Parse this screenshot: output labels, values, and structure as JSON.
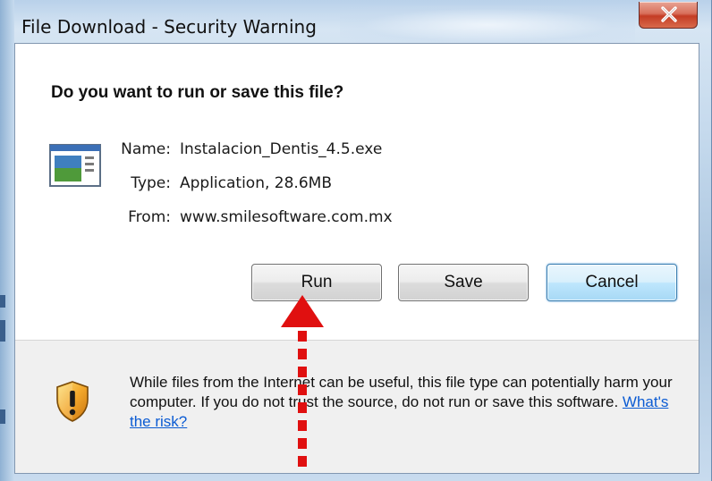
{
  "window": {
    "title": "File Download - Security Warning",
    "close_icon": "close-icon"
  },
  "dialog": {
    "question": "Do you want to run or save this file?",
    "file_icon": "application-window-icon",
    "fields": [
      {
        "label": "Name:",
        "value": "Instalacion_Dentis_4.5.exe"
      },
      {
        "label": "Type:",
        "value": "Application, 28.6MB"
      },
      {
        "label": "From:",
        "value": "www.smilesoftware.com.mx"
      }
    ],
    "buttons": {
      "run": "Run",
      "save": "Save",
      "cancel": "Cancel"
    },
    "warning": {
      "icon": "shield-warning-icon",
      "text": "While files from the Internet can be useful, this file type can potentially harm your computer. If you do not trust the source, do not run or save this software.",
      "link": "What's the risk?"
    }
  },
  "annotation": {
    "arrow_icon": "red-dotted-arrow-icon",
    "color": "#e01010"
  },
  "colors": {
    "link": "#0b5bd3",
    "close_button": "#c43c24",
    "default_button_border": "#3c7fb1"
  }
}
